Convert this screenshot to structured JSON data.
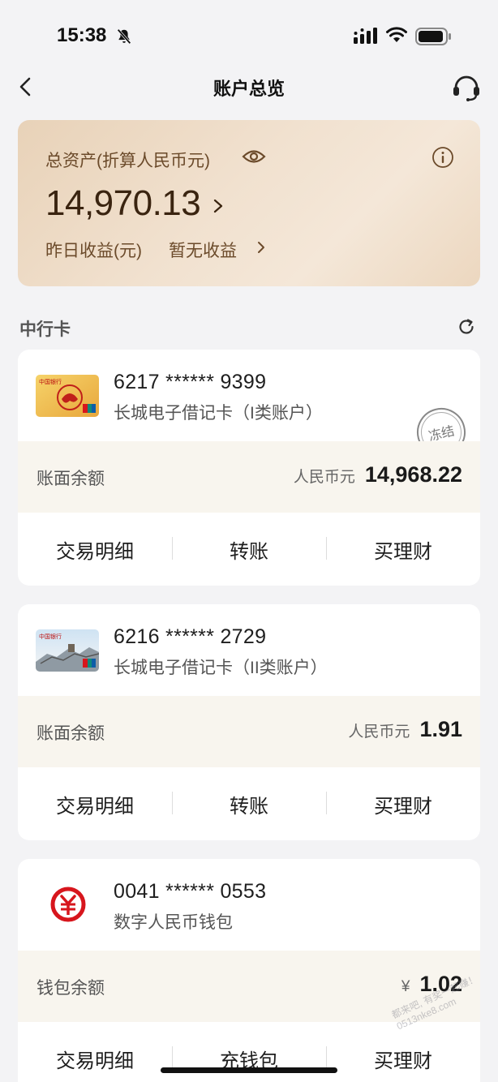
{
  "status_bar": {
    "time": "15:38"
  },
  "nav": {
    "title": "账户总览"
  },
  "assets": {
    "label": "总资产(折算人民币元)",
    "amount": "14,970.13",
    "yield_label": "昨日收益(元)",
    "yield_value": "暂无收益"
  },
  "section": {
    "title": "中行卡"
  },
  "accounts": [
    {
      "number": "6217 ****** 9399",
      "type": "长城电子借记卡（I类账户）",
      "stamp": "冻结",
      "balance_label": "账面余额",
      "currency": "人民币元",
      "balance": "14,968.22",
      "actions": [
        "交易明细",
        "转账",
        "买理财"
      ]
    },
    {
      "number": "6216 ****** 2729",
      "type": "长城电子借记卡（II类账户）",
      "balance_label": "账面余额",
      "currency": "人民币元",
      "balance": "1.91",
      "actions": [
        "交易明细",
        "转账",
        "买理财"
      ]
    },
    {
      "number": "0041 ****** 0553",
      "type": "数字人民币钱包",
      "balance_label": "钱包余额",
      "currency": "¥",
      "balance": "1.02",
      "actions": [
        "交易明细",
        "充钱包",
        "买理财"
      ]
    }
  ],
  "watermark": "都来吧, 有奖一起赚！ 0513nke8.com",
  "colors": {
    "asset_card": "#eddcc8",
    "balance_row": "#f8f5ee",
    "ecny_red": "#d7161d",
    "page_bg": "#f3f3f5"
  },
  "icons": [
    "bell-slash-icon",
    "signal-icon",
    "wifi-icon",
    "battery-icon",
    "back-icon",
    "headset-icon",
    "eye-icon",
    "info-icon",
    "chevron-right-icon",
    "refresh-icon",
    "ecny-logo"
  ]
}
